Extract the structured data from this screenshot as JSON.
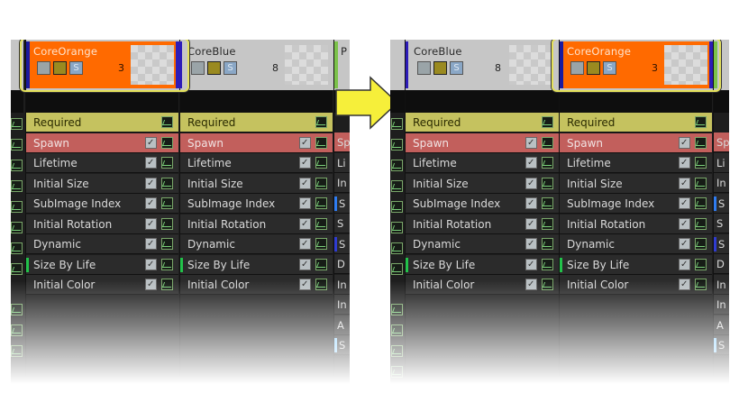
{
  "emitters": {
    "core_orange": {
      "name": "CoreOrange",
      "count": "3",
      "color": "#ff6a00",
      "bar_color": "#1a1aa0"
    },
    "core_blue": {
      "name": "CoreBlue",
      "count": "8",
      "color": "#c6c6c6",
      "bar_color": "#2d1cb8"
    }
  },
  "peek_label": "P",
  "modules": [
    {
      "label": "Required",
      "type": "required"
    },
    {
      "label": "Spawn",
      "type": "spawn"
    },
    {
      "label": "Lifetime",
      "type": "normal"
    },
    {
      "label": "Initial Size",
      "type": "normal"
    },
    {
      "label": "SubImage Index",
      "type": "normal"
    },
    {
      "label": "Initial Rotation",
      "type": "normal"
    },
    {
      "label": "Dynamic",
      "type": "normal"
    },
    {
      "label": "Size By Life",
      "type": "normal",
      "marker": "#22c24a"
    },
    {
      "label": "Initial Color",
      "type": "normal"
    }
  ],
  "clipped_letters": [
    "Sp",
    "Li",
    "In",
    "S",
    "S",
    "S",
    "D",
    "In",
    "In",
    "A",
    "S"
  ],
  "clipped_markers": {
    "3": "#2f7cf0",
    "5": "#2f3cd0",
    "10": "#8ad0ff"
  },
  "icons": {
    "check": "checkbox-icon",
    "graph": "curve-graph-icon",
    "grid": "grid-icon",
    "solo": "solo-s-icon"
  },
  "arrow_color": "#f6ef3a",
  "highlight_color": "#e3e05a"
}
